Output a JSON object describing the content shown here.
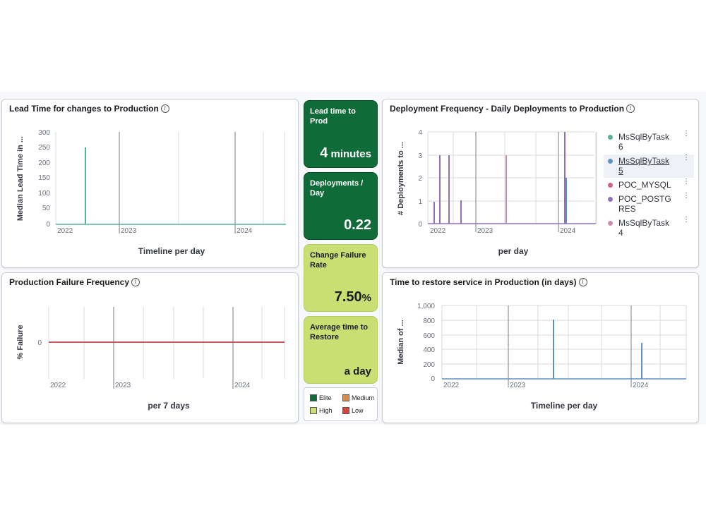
{
  "colors": {
    "elite": "#0f6b37",
    "high": "#c9df74",
    "medium": "#d58e4f",
    "low": "#d8443c",
    "lead_line": "#54b399",
    "failure_line": "#c1454b",
    "restore_line": "#6092c0"
  },
  "info_icon": "i",
  "lead_time": {
    "title": "Lead Time for changes to Production",
    "ylabel": "Median Lead Time in ...",
    "xlabel": "Timeline per day"
  },
  "production_failure": {
    "title": "Production Failure Frequency",
    "ylabel": "% Failure",
    "xlabel": "per 7 days"
  },
  "deployment_frequency": {
    "title": "Deployment Frequency - Daily Deployments to Production",
    "ylabel": "# Deployments to ...",
    "xlabel": "per day",
    "legend": [
      {
        "label": "MsSqlByTask 6",
        "color": "#54b399"
      },
      {
        "label": "MsSqlByTask 5",
        "color": "#6092c0"
      },
      {
        "label": "POC_MYSQL",
        "color": "#d36086"
      },
      {
        "label": "POC_POSTG RES",
        "color": "#9170b8"
      },
      {
        "label": "MsSqlByTask 4",
        "color": "#ca8eae"
      }
    ]
  },
  "restore": {
    "title": "Time to restore service in Production (in days)",
    "ylabel": "Median of ...",
    "xlabel": "Timeline per day"
  },
  "metrics": {
    "lead_time": {
      "label": "Lead time to Prod",
      "value": "4",
      "unit": " minutes"
    },
    "deployments": {
      "label": "Deployments / Day",
      "value": "0.22"
    },
    "failure_rate": {
      "label": "Change Failure Rate",
      "value": "7.50",
      "unit": "%"
    },
    "restore": {
      "label": "Average time to Restore",
      "value": "a day"
    }
  },
  "rating_legend": {
    "elite": "Elite",
    "medium": "Medium",
    "high": "High",
    "low": "Low"
  },
  "chart_data": [
    {
      "type": "line",
      "title": "Lead Time for changes to Production",
      "xlabel": "Timeline per day",
      "ylabel": "Median Lead Time in ...",
      "x_ticks": [
        "2022",
        "2023",
        "2024"
      ],
      "y_ticks": [
        0,
        50,
        100,
        150,
        200,
        250,
        300
      ],
      "ylim": [
        0,
        300
      ],
      "grid": true,
      "series": [
        {
          "points": [
            {
              "x": "2022-03",
              "y": 250
            }
          ]
        }
      ]
    },
    {
      "type": "line",
      "title": "Production Failure Frequency",
      "xlabel": "per 7 days",
      "ylabel": "% Failure",
      "x_ticks": [
        "2022",
        "2023",
        "2024"
      ],
      "y_ticks": [
        0
      ],
      "grid": true,
      "series": [
        {
          "points": [
            {
              "x": "2022-01",
              "y": 0
            },
            {
              "x": "2024-06",
              "y": 0
            }
          ]
        }
      ]
    },
    {
      "type": "bar",
      "title": "Deployment Frequency - Daily Deployments to Production",
      "xlabel": "per day",
      "ylabel": "# Deployments to ...",
      "x_ticks": [
        "2022",
        "2023",
        "2024"
      ],
      "y_ticks": [
        0,
        1,
        2,
        3,
        4
      ],
      "ylim": [
        0,
        4
      ],
      "grid": true,
      "legend_position": "right",
      "series": [
        {
          "name": "POC_POSTG RES",
          "points": [
            {
              "x": "2022-01",
              "y": 3
            },
            {
              "x": "2022-03",
              "y": 3
            },
            {
              "x": "2022-06",
              "y": 1
            },
            {
              "x": "2023-12",
              "y": 4
            }
          ]
        },
        {
          "name": "MsSqlByTask 4",
          "points": [
            {
              "x": "2023-04",
              "y": 3
            }
          ]
        },
        {
          "name": "MsSqlByTask 5",
          "points": [
            {
              "x": "2023-12",
              "y": 2
            }
          ]
        }
      ]
    },
    {
      "type": "line",
      "title": "Time to restore service in Production (in days)",
      "xlabel": "Timeline per day",
      "ylabel": "Median of ...",
      "x_ticks": [
        "2022",
        "2023",
        "2024"
      ],
      "y_ticks": [
        "0",
        "200",
        "400",
        "600",
        "800",
        "1,000"
      ],
      "ylim": [
        0,
        1000
      ],
      "grid": true,
      "series": [
        {
          "points": [
            {
              "x": "2023-05",
              "y": 810
            },
            {
              "x": "2024-01",
              "y": 490
            }
          ]
        }
      ]
    }
  ]
}
